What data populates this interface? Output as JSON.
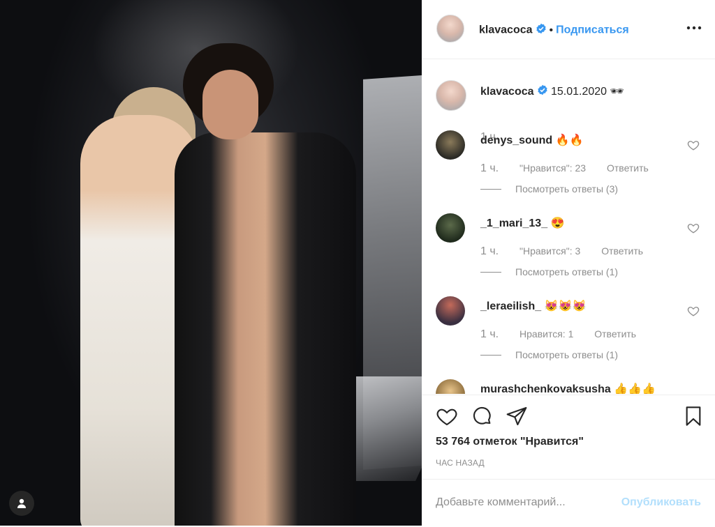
{
  "post": {
    "author": "klavacoca",
    "follow_label": "Подписаться",
    "dot": "•",
    "caption_date": "15.01.2020",
    "caption_emoji": "🕶",
    "caption_time": "1 ч.",
    "likes": "53 764 отметок \"Нравится\"",
    "posted_ago": "ЧАС НАЗАД",
    "comment_placeholder": "Добавьте комментарий...",
    "publish_label": "Опубликовать"
  },
  "comments": [
    {
      "user": "denys_sound",
      "text": "🔥🔥",
      "time": "1 ч.",
      "likes": "\"Нравится\": 23",
      "reply": "Ответить",
      "view_replies": "Посмотреть ответы (3)",
      "avatar_color": "#3b3a34"
    },
    {
      "user": "_1_mari_13_",
      "text": "😍",
      "time": "1 ч.",
      "likes": "\"Нравится\": 3",
      "reply": "Ответить",
      "view_replies": "Посмотреть ответы (1)",
      "avatar_color": "#2d3a2a"
    },
    {
      "user": "_leraeilish_",
      "text": "😻😻😻",
      "time": "1 ч.",
      "likes": "Нравится: 1",
      "reply": "Ответить",
      "view_replies": "Посмотреть ответы (1)",
      "avatar_color": "#4a3a44"
    },
    {
      "user": "murashchenkovaksusha",
      "text": "👍👍👍",
      "time": "",
      "likes": "",
      "reply": "",
      "view_replies": "",
      "avatar_color": "#c9a46a"
    }
  ],
  "colors": {
    "link": "#3897f0",
    "muted": "#8e8e8e",
    "verified": "#3897f0",
    "publish_disabled": "#b2dffc"
  }
}
